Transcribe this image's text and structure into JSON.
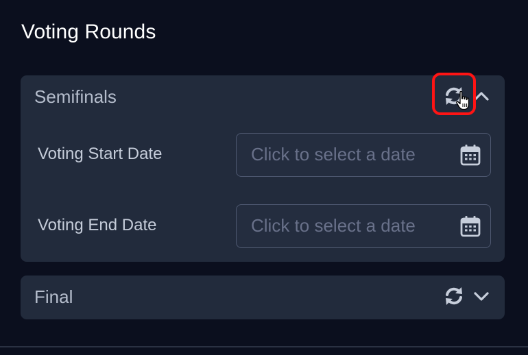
{
  "panel": {
    "title": "Voting Rounds"
  },
  "rounds": [
    {
      "name": "Semifinals",
      "expanded": true,
      "fields": [
        {
          "label": "Voting Start Date",
          "value": "",
          "placeholder": "Click to select a date"
        },
        {
          "label": "Voting End Date",
          "value": "",
          "placeholder": "Click to select a date"
        }
      ]
    },
    {
      "name": "Final",
      "expanded": false
    }
  ],
  "icons": {
    "sync": "sync-icon",
    "chevron_up": "chevron-up-icon",
    "chevron_down": "chevron-down-icon",
    "calendar": "calendar-icon",
    "cursor": "pointer-hand-icon"
  },
  "colors": {
    "background": "#0b0f1e",
    "card": "#222b3c",
    "highlight": "#ff1414",
    "muted_text": "#b5bdcc",
    "icon": "#c7cedb"
  }
}
